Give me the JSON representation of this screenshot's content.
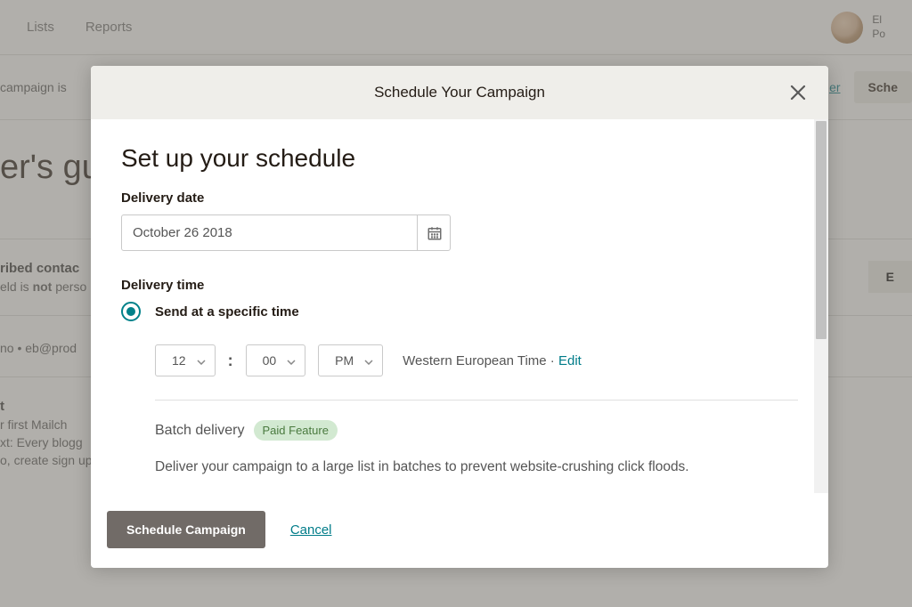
{
  "nav": {
    "lists": "Lists",
    "reports": "Reports",
    "user_line1": "El",
    "user_line2": "Po"
  },
  "bg": {
    "campaign_is": "campaign is",
    "later_link": "er",
    "schedule_btn": "Sche",
    "title": "er's gu",
    "contacts_heading": "ribed contac",
    "contacts_sub_prefix": "eld is ",
    "contacts_sub_bold": "not",
    "contacts_sub_suffix": " perso",
    "edit_btn": "E",
    "from_line": "no • eb@prod",
    "subject_heading": "t",
    "subject_line1": "r first Mailch",
    "subject_line2": "xt: Every blogg",
    "subject_line3": "o, create sign up forms and send your very first email!"
  },
  "modal": {
    "title": "Schedule Your Campaign",
    "heading": "Set up your schedule",
    "delivery_date_label": "Delivery date",
    "delivery_date_value": "October 26 2018",
    "delivery_time_label": "Delivery time",
    "radio_label": "Send at a specific time",
    "hour": "12",
    "minute": "00",
    "ampm": "PM",
    "timezone": "Western European Time",
    "dot": " · ",
    "edit": "Edit",
    "batch_label": "Batch delivery",
    "badge": "Paid Feature",
    "batch_desc": "Deliver your campaign to a large list in batches to prevent website-crushing click floods.",
    "schedule_btn": "Schedule Campaign",
    "cancel": "Cancel"
  }
}
